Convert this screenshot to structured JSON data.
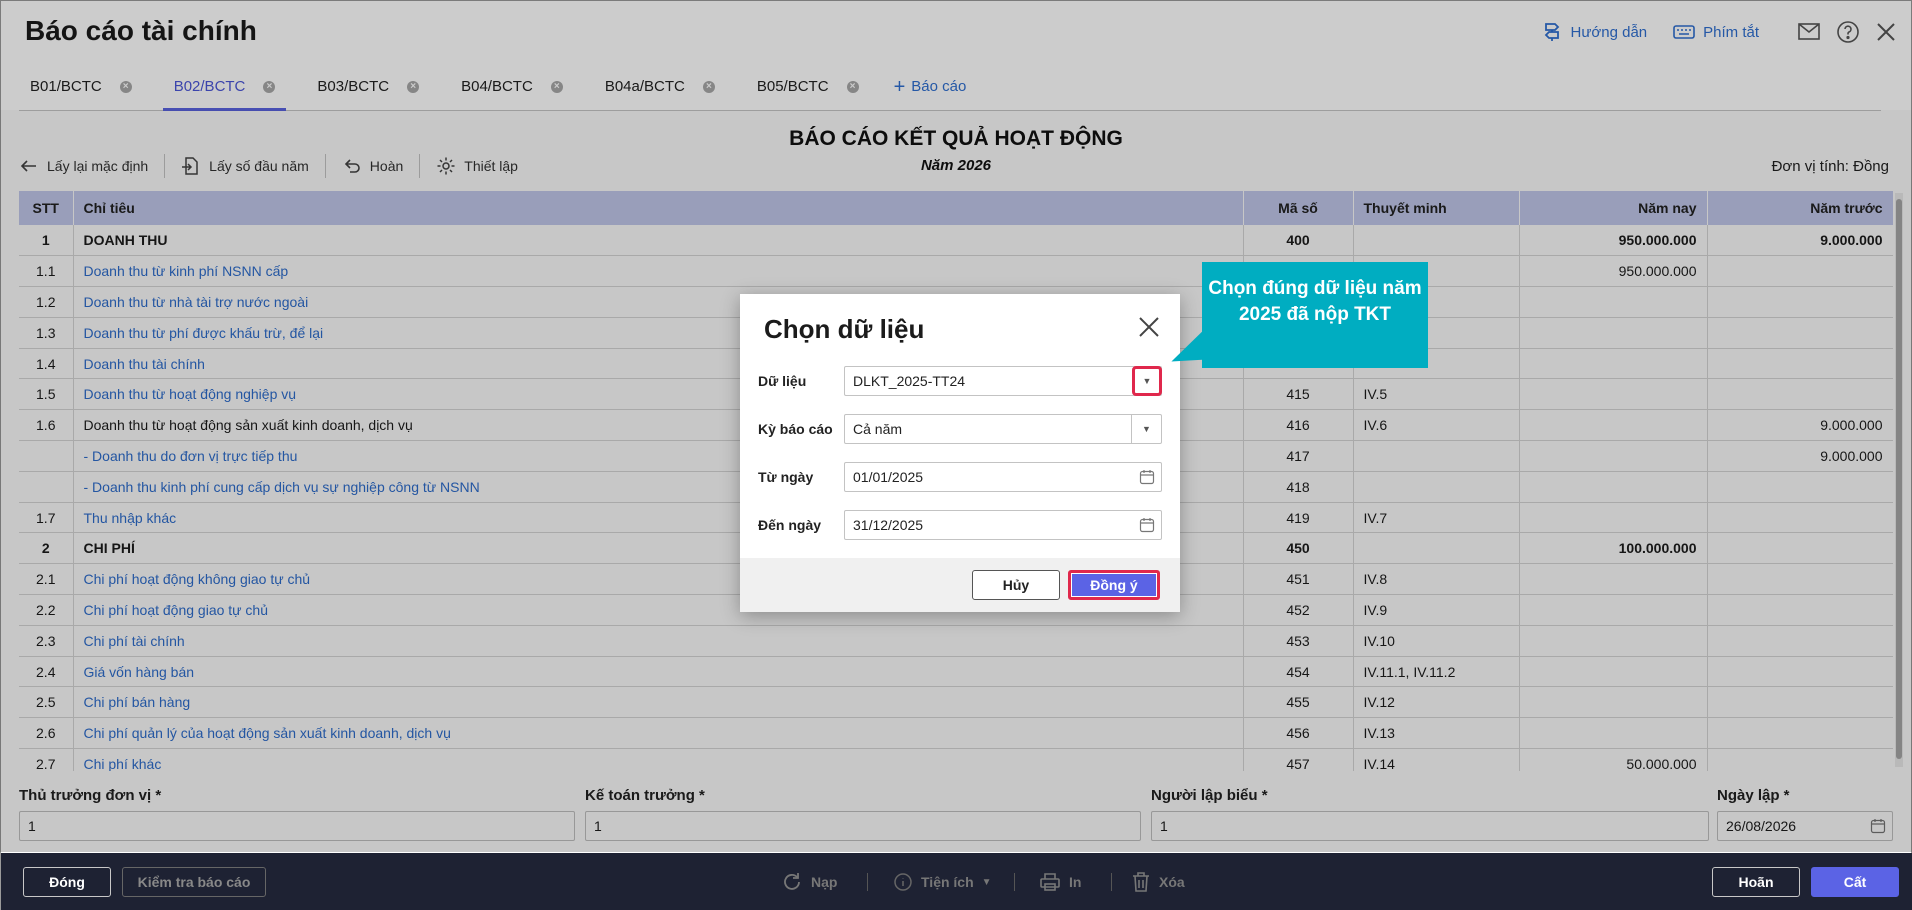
{
  "app": {
    "title": "Báo cáo tài chính",
    "guide_label": "Hướng dẫn",
    "shortcut_label": "Phím tắt"
  },
  "tabs": [
    {
      "label": "B01/BCTC"
    },
    {
      "label": "B02/BCTC"
    },
    {
      "label": "B03/BCTC"
    },
    {
      "label": "B04/BCTC"
    },
    {
      "label": "B04a/BCTC"
    },
    {
      "label": "B05/BCTC"
    }
  ],
  "add_report_label": "Báo cáo",
  "toolbar": {
    "reset_label": "Lấy lại mặc định",
    "opening_label": "Lấy số đầu năm",
    "undo_label": "Hoàn",
    "settings_label": "Thiết lập"
  },
  "report": {
    "title": "BÁO CÁO KẾT QUẢ HOẠT ĐỘNG",
    "subtitle": "Năm 2026",
    "unit": "Đơn vị tính: Đồng"
  },
  "table": {
    "headers": {
      "stt": "STT",
      "item": "Chỉ tiêu",
      "code": "Mã số",
      "note": "Thuyết minh",
      "current": "Năm nay",
      "previous": "Năm trước"
    },
    "rows": [
      {
        "stt": "1",
        "item": "DOANH THU",
        "code": "400",
        "note": "",
        "current": "950.000.000",
        "previous": "9.000.000"
      },
      {
        "stt": "1.1",
        "item": "Doanh thu từ kinh phí NSNN cấp",
        "code": "",
        "note": "",
        "current": "950.000.000",
        "previous": ""
      },
      {
        "stt": "1.2",
        "item": "Doanh thu từ nhà tài trợ nước ngoài",
        "code": "",
        "note": "",
        "current": "",
        "previous": ""
      },
      {
        "stt": "1.3",
        "item": "Doanh thu từ phí được khấu trừ, để lại",
        "code": "",
        "note": "",
        "current": "",
        "previous": ""
      },
      {
        "stt": "1.4",
        "item": "Doanh thu tài chính",
        "code": "",
        "note": "",
        "current": "",
        "previous": ""
      },
      {
        "stt": "1.5",
        "item": "Doanh thu từ hoạt động nghiệp vụ",
        "code": "415",
        "note": "IV.5",
        "current": "",
        "previous": ""
      },
      {
        "stt": "1.6",
        "item": "Doanh thu từ hoạt động sản xuất kinh doanh, dịch vụ",
        "code": "416",
        "note": "IV.6",
        "current": "",
        "previous": "9.000.000"
      },
      {
        "stt": "",
        "item": "- Doanh thu do đơn vị trực tiếp thu",
        "code": "417",
        "note": "",
        "current": "",
        "previous": "9.000.000"
      },
      {
        "stt": "",
        "item": "- Doanh thu kinh phí cung cấp dịch vụ sự nghiệp công từ NSNN",
        "code": "418",
        "note": "",
        "current": "",
        "previous": ""
      },
      {
        "stt": "1.7",
        "item": "Thu nhập khác",
        "code": "419",
        "note": "IV.7",
        "current": "",
        "previous": ""
      },
      {
        "stt": "2",
        "item": "CHI PHÍ",
        "code": "450",
        "note": "",
        "current": "100.000.000",
        "previous": ""
      },
      {
        "stt": "2.1",
        "item": "Chi phí hoạt động không giao tự chủ",
        "code": "451",
        "note": "IV.8",
        "current": "",
        "previous": ""
      },
      {
        "stt": "2.2",
        "item": "Chi phí hoạt động giao tự chủ",
        "code": "452",
        "note": "IV.9",
        "current": "",
        "previous": ""
      },
      {
        "stt": "2.3",
        "item": "Chi phí tài chính",
        "code": "453",
        "note": "IV.10",
        "current": "",
        "previous": ""
      },
      {
        "stt": "2.4",
        "item": "Giá vốn hàng bán",
        "code": "454",
        "note": "IV.11.1, IV.11.2",
        "current": "",
        "previous": ""
      },
      {
        "stt": "2.5",
        "item": "Chi phí bán hàng",
        "code": "455",
        "note": "IV.12",
        "current": "",
        "previous": ""
      },
      {
        "stt": "2.6",
        "item": "Chi phí quản lý của hoạt động sản xuất kinh doanh, dịch vụ",
        "code": "456",
        "note": "IV.13",
        "current": "",
        "previous": ""
      },
      {
        "stt": "2.7",
        "item": "Chi phí khác",
        "code": "457",
        "note": "IV.14",
        "current": "50.000.000",
        "previous": ""
      }
    ]
  },
  "footer": {
    "head_label": "Thủ trưởng đơn vị *",
    "head_value": "1",
    "accountant_label": "Kế toán trưởng *",
    "accountant_value": "1",
    "preparer_label": "Người lập biểu *",
    "preparer_value": "1",
    "date_label": "Ngày lập *",
    "date_value": "26/08/2026"
  },
  "bottombar": {
    "close_label": "Đóng",
    "check_label": "Kiểm tra báo cáo",
    "load_label": "Nạp",
    "utility_label": "Tiện ích",
    "print_label": "In",
    "delete_label": "Xóa",
    "undo_label": "Hoãn",
    "save_label": "Cất"
  },
  "dialog": {
    "title": "Chọn dữ liệu",
    "data_label": "Dữ liệu",
    "data_value": "DLKT_2025-TT24",
    "period_label": "Kỳ báo cáo",
    "period_value": "Cả năm",
    "from_label": "Từ ngày",
    "from_value": "01/01/2025",
    "to_label": "Đến ngày",
    "to_value": "31/12/2025",
    "cancel_label": "Hủy",
    "ok_label": "Đồng ý"
  },
  "callout": {
    "text": "Chọn đúng dữ liệu năm 2025 đã nộp TKT"
  },
  "colors": {
    "accent": "#5b63e5",
    "link": "#2f6fd0",
    "header_bg": "#c4cbef",
    "callout": "#00adc1",
    "highlight": "#e0284c",
    "bottombar": "#1e2233"
  }
}
